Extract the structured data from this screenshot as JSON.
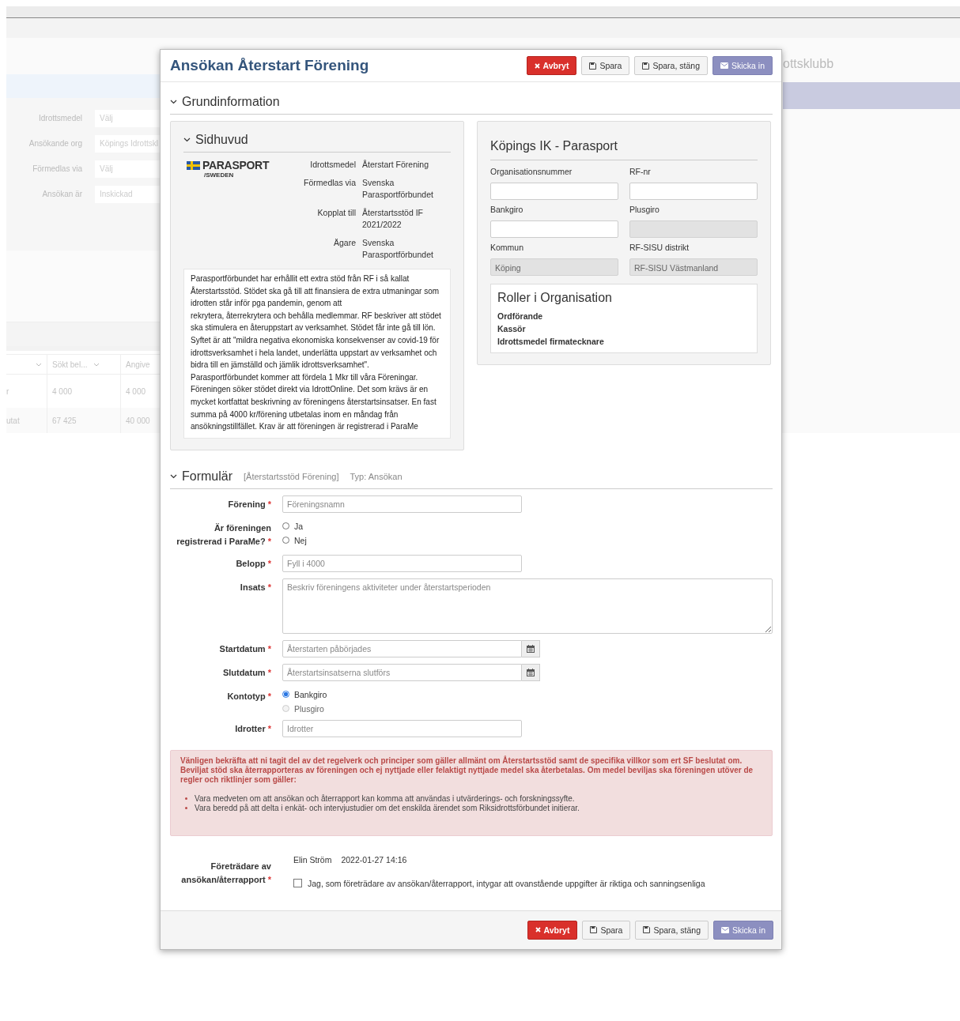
{
  "background": {
    "title_fragment": "ottsklubb",
    "filters": [
      {
        "label": "Idrottsmedel",
        "value": "Välj"
      },
      {
        "label": "Ansökande org",
        "value": "Köpings Idrottskl"
      },
      {
        "label": "Förmedlas via",
        "value": "Välj"
      },
      {
        "label": "Ansökan är",
        "value": "Inskickad"
      }
    ],
    "table": {
      "columns": [
        {
          "menu": true
        },
        {
          "label": "Sökt bel...",
          "menu": true
        },
        {
          "label": "Angive",
          "menu": false
        }
      ],
      "rows": [
        [
          "r",
          "4 000",
          "4 000"
        ],
        [
          "utat",
          "67 425",
          "40 000"
        ]
      ]
    }
  },
  "modal": {
    "title": "Ansökan Återstart Förening",
    "buttons": [
      {
        "kind": "cancel",
        "label": "Avbryt"
      },
      {
        "kind": "save",
        "label": "Spara"
      },
      {
        "kind": "save_close",
        "label": "Spara, stäng"
      },
      {
        "kind": "submit",
        "label": "Skicka in"
      }
    ],
    "grund": {
      "title": "Grundinformation",
      "expanded": true,
      "sidhuvud": {
        "title": "Sidhuvud",
        "expanded": true,
        "logo": {
          "name": "PARASPORT",
          "sub": "/SWEDEN"
        },
        "info": [
          {
            "label": "Idrottsmedel",
            "value": "Återstart Förening"
          },
          {
            "label": "Förmedlas via",
            "value": "Svenska Parasportförbundet"
          },
          {
            "label": "Kopplat till",
            "value": "Återstartsstöd IF 2021/2022"
          },
          {
            "label": "Ägare",
            "value": "Svenska Parasportförbundet"
          }
        ],
        "description": "Parasportförbundet har erhållit ett extra stöd från RF i så kallat Återstartsstöd. Stödet ska gå till att finansiera de extra utmaningar som idrotten står inför pga pandemin, genom att\nrekrytera, återrekrytera och behålla medlemmar. RF beskriver att stödet ska stimulera en återuppstart av verksamhet. Stödet får inte gå till lön. Syftet är att \"mildra negativa ekonomiska konsekvenser av covid-19 för idrottsverksamhet i hela landet, underlätta uppstart av verksamhet och bidra till en jämställd och jämlik idrottsverksamhet\".\nParasportförbundet kommer att fördela 1 Mkr till våra Föreningar. Föreningen söker stödet direkt via IdrottOnline. Det som krävs är en mycket kortfattat beskrivning av föreningens återstartsinsatser. En fast summa på 4000 kr/förening utbetalas inom en måndag från ansökningstillfället. Krav är att föreningen är registrerad i ParaMe"
      },
      "org": {
        "title": "Köpings IK - Parasport",
        "fields": [
          {
            "label": "Organisationsnummer",
            "disabled": false
          },
          {
            "label": "RF-nr",
            "disabled": false
          },
          {
            "label": "Bankgiro",
            "disabled": false
          },
          {
            "label": "Plusgiro",
            "disabled": true
          },
          {
            "label": "Kommun",
            "value": "Köping",
            "disabled": true
          },
          {
            "label": "RF-SISU distrikt",
            "value": "RF-SISU Västmanland",
            "disabled": true
          }
        ],
        "roles": {
          "title": "Roller i Organisation",
          "items": [
            "Ordförande",
            "Kassör",
            "Idrottsmedel firmatecknare"
          ]
        }
      }
    },
    "form": {
      "title": "Formulär",
      "expanded": true,
      "tag": "[Återstartsstöd Förening]",
      "type": "Typ: Ansökan",
      "rows": [
        {
          "kind": "text",
          "label": "Förening",
          "required": "*",
          "placeholder": "Föreningsnamn"
        },
        {
          "kind": "radio",
          "label": "Är föreningen registrerad i ParaMe?",
          "required": "*",
          "options": [
            {
              "label": "Ja",
              "selected": false,
              "disabled": false
            },
            {
              "label": "Nej",
              "selected": false,
              "disabled": false
            }
          ]
        },
        {
          "kind": "text",
          "label": "Belopp",
          "required": "*",
          "placeholder": "Fyll i 4000"
        },
        {
          "kind": "textarea",
          "label": "Insats",
          "required": "*",
          "placeholder": "Beskriv föreningens aktiviteter under återstartsperioden"
        },
        {
          "kind": "date",
          "label": "Startdatum",
          "required": "*",
          "placeholder": "Återstarten påbörjades"
        },
        {
          "kind": "date",
          "label": "Slutdatum",
          "required": "*",
          "placeholder": "Återstartsinsatserna slutförs"
        },
        {
          "kind": "radio",
          "label": "Kontotyp",
          "required": "*",
          "options": [
            {
              "label": "Bankgiro",
              "selected": true,
              "disabled": false
            },
            {
              "label": "Plusgiro",
              "selected": false,
              "disabled": true
            }
          ]
        },
        {
          "kind": "text",
          "label": "Idrotter",
          "required": "*",
          "placeholder": "Idrotter"
        }
      ],
      "alert": {
        "text": "Vänligen bekräfta att ni tagit del av det regelverk och principer som gäller allmänt om Återstartsstöd samt de specifika villkor som ert SF beslutat om. Beviljat stöd ska återrapporteras av föreningen och ej nyttjade eller felaktigt nyttjade medel ska återbetalas. Om medel beviljas ska föreningen utöver de regler och riktlinjer som gäller:",
        "bullets": [
          "Vara medveten om att ansökan och återrapport kan komma att användas i utvärderings- och forskningssyfte.",
          "Vara beredd på att delta i enkät- och intervjustudier om det enskilda ärendet som Riksidrottsförbundet initierar."
        ]
      },
      "representative": {
        "label": "Företrädare av ansökan/återrapport",
        "required": "*",
        "name": "Elin Ström",
        "time": "2022-01-27 14:16",
        "confirm": {
          "label": "Jag, som företrädare av ansökan/återrapport, intygar att ovanstående uppgifter är riktiga och sanningsenliga",
          "checked": false
        }
      }
    },
    "footer_buttons": [
      {
        "kind": "cancel",
        "label": "Avbryt"
      },
      {
        "kind": "save",
        "label": "Spara"
      },
      {
        "kind": "save_close",
        "label": "Spara, stäng"
      },
      {
        "kind": "submit",
        "label": "Skicka in"
      }
    ]
  }
}
